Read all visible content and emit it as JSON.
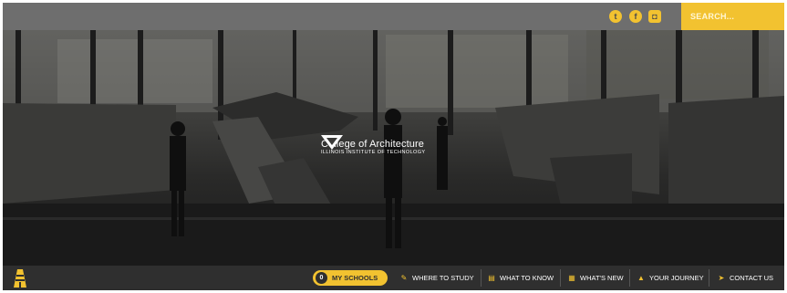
{
  "header": {
    "social": [
      {
        "name": "twitter",
        "glyph": "t"
      },
      {
        "name": "facebook",
        "glyph": "f"
      },
      {
        "name": "instagram",
        "glyph": "◘"
      }
    ],
    "search": {
      "placeholder": "SEARCH..."
    }
  },
  "hero": {
    "title": "College of Architecture",
    "subtitle": "ILLINOIS INSTITUTE OF TECHNOLOGY"
  },
  "nav": {
    "my_schools": {
      "count": "0",
      "label": "MY SCHOOLS"
    },
    "items": [
      {
        "label": "WHERE TO STUDY",
        "icon": "pencil-icon",
        "glyph": "✎"
      },
      {
        "label": "WHAT TO KNOW",
        "icon": "document-icon",
        "glyph": "▤"
      },
      {
        "label": "WHAT'S NEW",
        "icon": "calendar-icon",
        "glyph": "▦"
      },
      {
        "label": "YOUR JOURNEY",
        "icon": "road-icon",
        "glyph": "▲"
      },
      {
        "label": "CONTACT US",
        "icon": "paper-plane-icon",
        "glyph": "➤"
      }
    ]
  },
  "colors": {
    "accent": "#f2c230",
    "topbar": "#6e6e6e",
    "nav": "#2f2f2f"
  }
}
